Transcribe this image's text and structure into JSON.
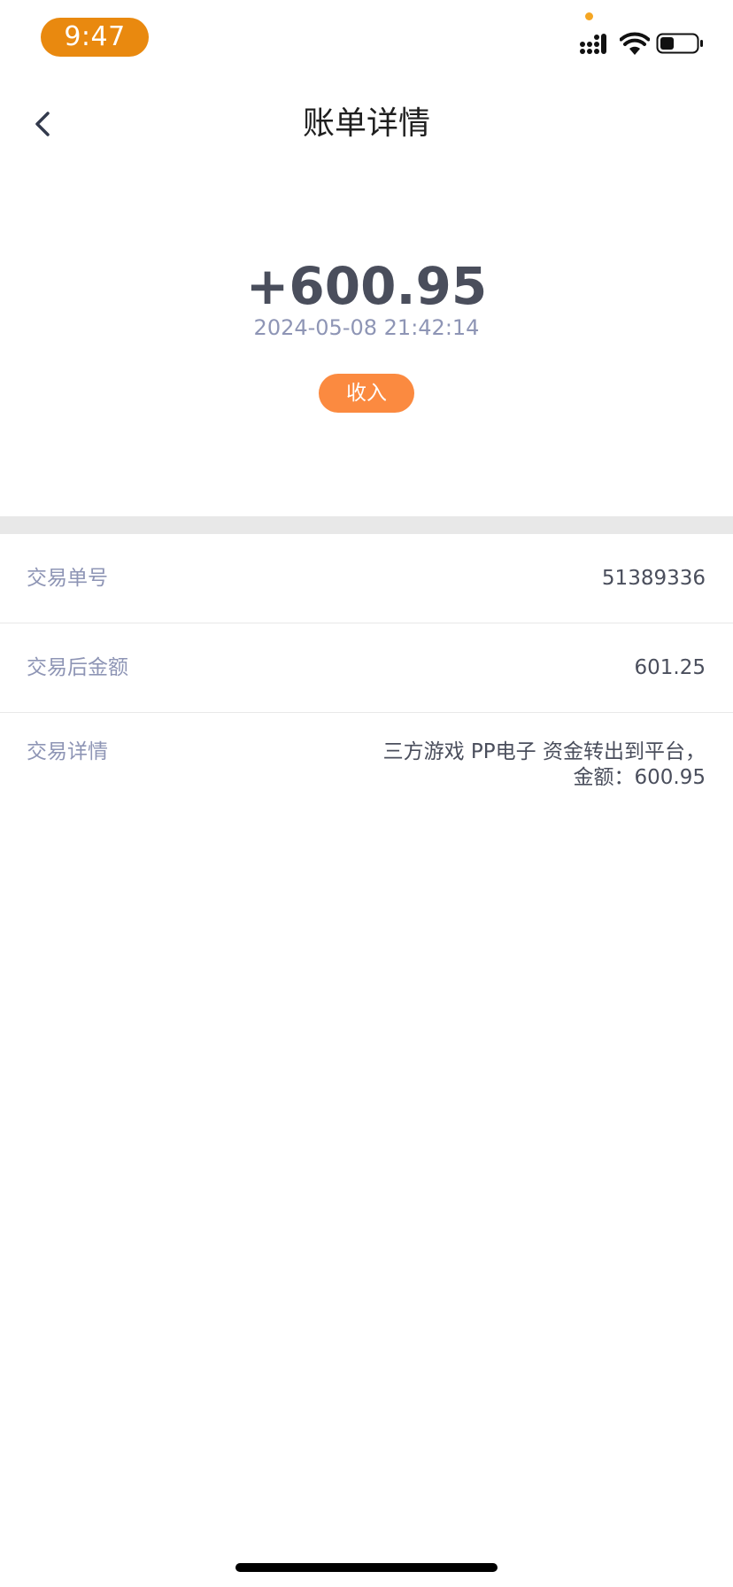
{
  "status_bar": {
    "time": "9:47",
    "signal_icon": "cellular-signal-icon",
    "wifi_icon": "wifi-icon",
    "battery_icon": "battery-icon",
    "accent_color": "#e9890f"
  },
  "nav": {
    "back_icon": "chevron-left-icon",
    "title": "账单详情"
  },
  "summary": {
    "amount": "+600.95",
    "datetime": "2024-05-08 21:42:14",
    "type_badge": "收入",
    "badge_color": "#fb8a40"
  },
  "details": [
    {
      "label": "交易单号",
      "value": "51389336"
    },
    {
      "label": "交易后金额",
      "value": "601.25"
    },
    {
      "label": "交易详情",
      "value_line1": "三方游戏 PP电子 资金转出到平台，",
      "value_line2": "金额：600.95"
    }
  ]
}
